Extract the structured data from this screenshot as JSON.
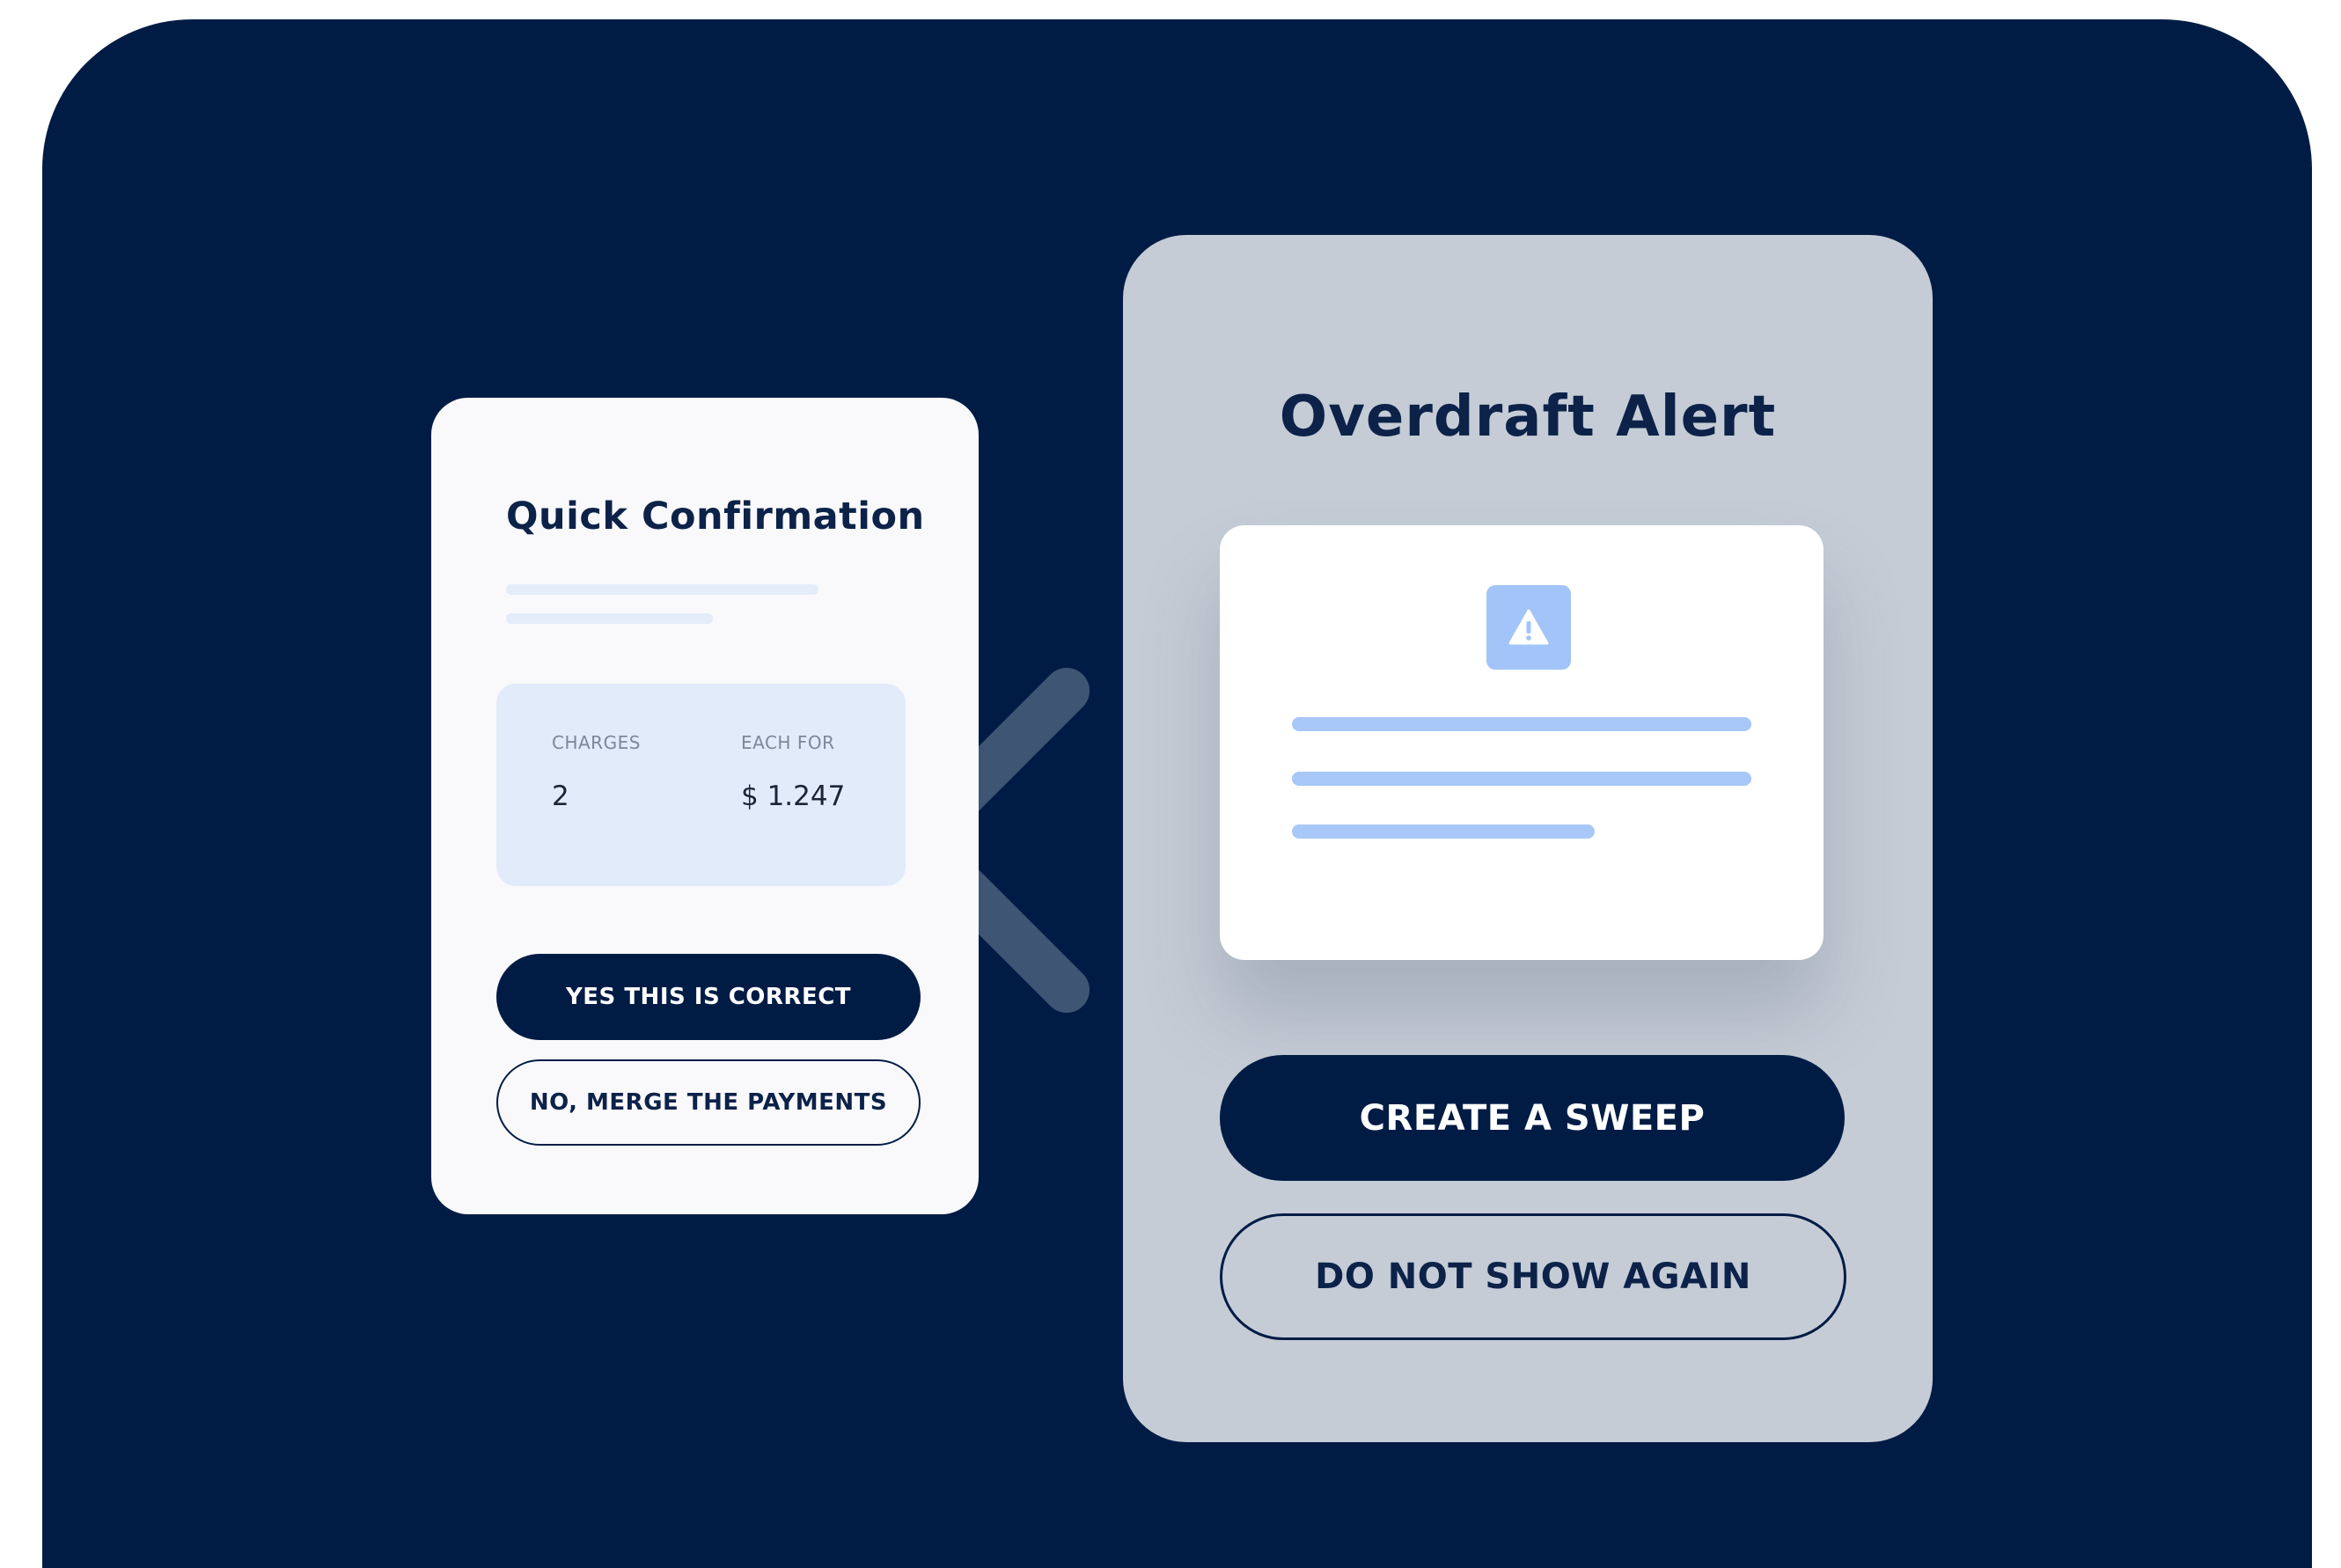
{
  "colors": {
    "background": "#001c45",
    "card_light": "#f9f9fb",
    "card_gray": "#c5ccd6",
    "summary_fill": "#e2ebfa",
    "accent_blue": "#a7c8f8",
    "primary_navy": "#001c45"
  },
  "quick_confirmation": {
    "title": "Quick Confirmation",
    "charges_label": "CHARGES",
    "charges_value": "2",
    "each_for_label": "EACH FOR",
    "each_for_value": "$ 1.247",
    "confirm_button": "YES THIS IS CORRECT",
    "merge_button": "NO, MERGE THE PAYMENTS"
  },
  "overdraft_alert": {
    "title": "Overdraft Alert",
    "icon": "warning-icon",
    "sweep_button": "CREATE A SWEEP",
    "dismiss_button": "DO NOT SHOW AGAIN"
  },
  "decoration": {
    "icon": "chevron-left-icon"
  }
}
